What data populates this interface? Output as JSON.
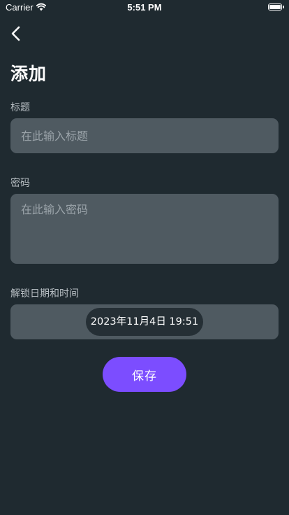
{
  "status_bar": {
    "carrier": "Carrier",
    "time": "5:51 PM"
  },
  "header": {
    "back_icon": "chevron-left-icon",
    "title": "添加"
  },
  "form": {
    "title_label": "标题",
    "title_placeholder": "在此输入标题",
    "title_value": "",
    "password_label": "密码",
    "password_placeholder": "在此输入密码",
    "password_value": "",
    "unlock_label": "解锁日期和时间",
    "unlock_datetime": "2023年11月4日 19:51"
  },
  "actions": {
    "save_label": "保存"
  },
  "colors": {
    "background": "#1f2a30",
    "field": "#4f5a61",
    "accent": "#7c4dff"
  }
}
